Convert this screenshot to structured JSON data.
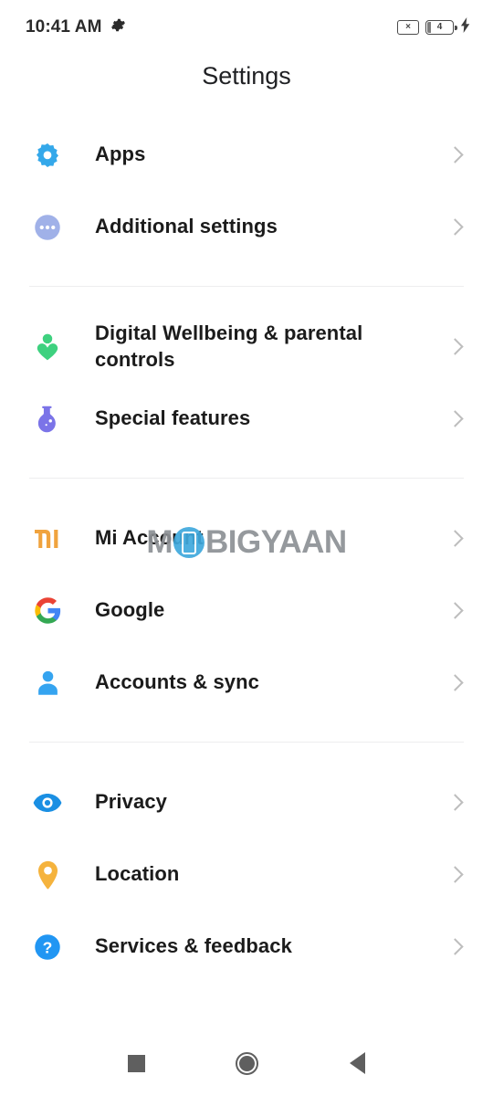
{
  "status_bar": {
    "clock": "10:41 AM",
    "gear_icon": "gear-icon",
    "sim_icon_label": "×",
    "battery_level": "4",
    "charging_icon": "⚡"
  },
  "header": {
    "title": "Settings"
  },
  "watermark": {
    "part1": "M",
    "part2": "BIGYAAN",
    "full_text": "MOBIGYAAN",
    "circle_color": "#3fa9dd",
    "text_color": "#8d9195"
  },
  "groups": [
    {
      "items": [
        {
          "label": "Apps",
          "icon": "gear-icon",
          "color": "#34a8ea"
        },
        {
          "label": "Additional settings",
          "icon": "three-dots-circle-icon",
          "color": "#a0b1e8"
        }
      ]
    },
    {
      "items": [
        {
          "label": "Digital Wellbeing & parental controls",
          "icon": "person-heart-icon",
          "color": "#3ed17f"
        },
        {
          "label": "Special features",
          "icon": "flask-icon",
          "color": "#7b74e8"
        }
      ]
    },
    {
      "items": [
        {
          "label": "Mi Account",
          "icon": "mi-logo-icon",
          "color": "#f5a council"
        },
        {
          "label": "Google",
          "icon": "google-g-icon",
          "color": "#4285f4"
        },
        {
          "label": "Accounts & sync",
          "icon": "person-icon",
          "color": "#35a4f0"
        }
      ]
    },
    {
      "items": [
        {
          "label": "Privacy",
          "icon": "eye-icon",
          "color": "#1a8fe3"
        },
        {
          "label": "Location",
          "icon": "map-pin-icon",
          "color": "#f5b33d"
        },
        {
          "label": "Services & feedback",
          "icon": "question-circle-icon",
          "color": "#2196f3"
        }
      ]
    }
  ],
  "nav_bar": {
    "recents_label": "recents-square-icon",
    "home_label": "home-circle-icon",
    "back_label": "back-triangle-icon"
  }
}
